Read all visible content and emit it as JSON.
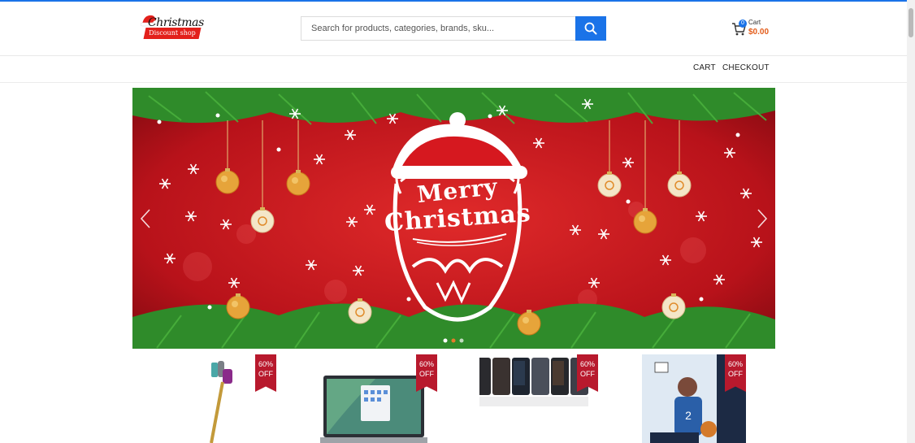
{
  "logo": {
    "title": "Christmas",
    "subtitle": "Discount shop"
  },
  "search": {
    "placeholder": "Search for products, categories, brands, sku..."
  },
  "cart": {
    "count": "0",
    "label": "Cart",
    "total": "$0.00"
  },
  "nav": {
    "links": [
      "CART",
      "CHECKOUT"
    ]
  },
  "banner": {
    "line1": "Merry",
    "line2": "Christmas"
  },
  "products": [
    {
      "badge_pct": "60%",
      "badge_off": "OFF",
      "image": "stick-vacuum"
    },
    {
      "badge_pct": "60%",
      "badge_off": "OFF",
      "image": "laptop"
    },
    {
      "badge_pct": "60%",
      "badge_off": "OFF",
      "image": "smartphones"
    },
    {
      "badge_pct": "60%",
      "badge_off": "OFF",
      "image": "trading-card-box"
    }
  ],
  "colors": {
    "accent": "#1a73e8",
    "badge": "#b8192d",
    "price": "#e35c1a",
    "banner_red": "#c4141c"
  }
}
